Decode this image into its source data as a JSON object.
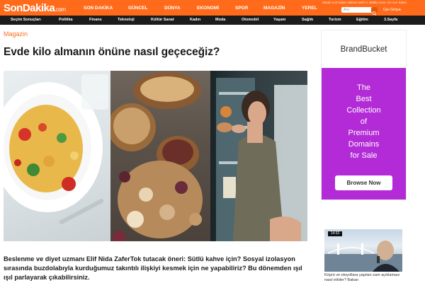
{
  "header": {
    "logo_main": "SonDakika",
    "logo_suffix": ".com",
    "nav": [
      "SON DAKİKA",
      "GÜNCEL",
      "DÜNYA",
      "EKONOMİ",
      "SPOR",
      "MAGAZİN",
      "YEREL"
    ],
    "top_right_text": "Sitede son haber ekleme tarihi 1 dakika önce. En son haber",
    "search_placeholder": "Ara",
    "login_label": "Üye Girişi"
  },
  "subnav": [
    "Seçim Sonuçları",
    "Politika",
    "Finans",
    "Teknoloji",
    "Kültür Sanat",
    "Kadın",
    "Moda",
    "Otomobil",
    "Yaşam",
    "Sağlık",
    "Turizm",
    "Eğitim",
    "3.Sayfa"
  ],
  "article": {
    "category": "Magazin",
    "title": "Evde kilo almanın önüne nasıl geçeceğiz?",
    "summary": "Beslenme ve diyet uzmanı Elif Nida ZaferTok tutacak öneri: Sütlü kahve için? Sosyal izolasyon sırasında buzdolabıyla kurduğumuz takıntılı ilişkiyi kesmek için ne yapabiliriz? Bu dönemden ışıl ışıl parlayarak çıkabilirsiniz."
  },
  "ad": {
    "brand": "BrandBucket",
    "lines": [
      "The",
      "Best",
      "Collection",
      "of",
      "Premium",
      "Domains",
      "for Sale"
    ],
    "button": "Browse Now"
  },
  "side_card": {
    "badge": "14:32",
    "text": "Köprü ve otoyollara yapılan zam açıklaması nasıl etkiler? Bakan"
  },
  "colors": {
    "accent": "#ff6b1a",
    "subnav_bg": "#1c1c1c",
    "ad_bg": "#b22bd6"
  }
}
